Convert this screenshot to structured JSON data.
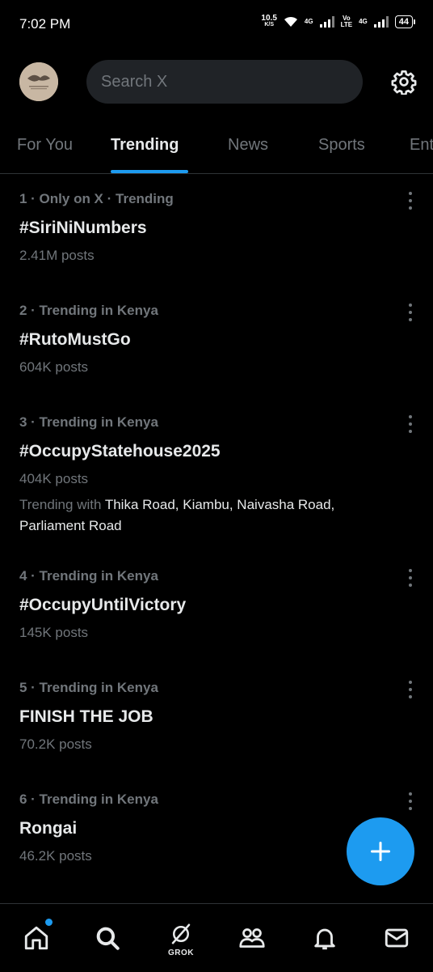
{
  "status_bar": {
    "time": "7:02 PM",
    "net_speed": "10.5",
    "net_speed_unit": "K/S",
    "sim1_label": "4G",
    "volte_top": "Vo",
    "volte_bottom": "LTE",
    "sim2_label": "4G",
    "battery": "44"
  },
  "header": {
    "search_placeholder": "Search X"
  },
  "tabs": [
    {
      "label": "For You"
    },
    {
      "label": "Trending"
    },
    {
      "label": "News"
    },
    {
      "label": "Sports"
    },
    {
      "label": "Ent"
    }
  ],
  "active_tab": "Trending",
  "trends": [
    {
      "meta": "1 · Only on X · Trending",
      "title": "#SiriNiNumbers",
      "count": "2.41M posts"
    },
    {
      "meta": "2 · Trending in Kenya",
      "title": "#RutoMustGo",
      "count": "604K posts"
    },
    {
      "meta": "3 · Trending in Kenya",
      "title": "#OccupyStatehouse2025",
      "count": "404K posts",
      "with_prefix": "Trending with",
      "with_names": "Thika Road, Kiambu, Naivasha Road, Parliament Road"
    },
    {
      "meta": "4 · Trending in Kenya",
      "title": "#OccupyUntilVictory",
      "count": "145K posts"
    },
    {
      "meta": "5 · Trending in Kenya",
      "title": "FINISH THE JOB",
      "count": "70.2K posts"
    },
    {
      "meta": "6 · Trending in Kenya",
      "title": "Rongai",
      "count": "46.2K posts"
    }
  ],
  "bottom_nav": {
    "grok_label": "GROK"
  },
  "colors": {
    "background": "#000000",
    "accent": "#1d9bf0",
    "muted_text": "#71767b",
    "primary_text": "#e7e9ea"
  },
  "icons": [
    "settings-gear-icon",
    "more-vertical-icon",
    "compose-plus-icon",
    "home-icon",
    "search-icon",
    "grok-icon",
    "communities-icon",
    "bell-icon",
    "mail-icon"
  ]
}
